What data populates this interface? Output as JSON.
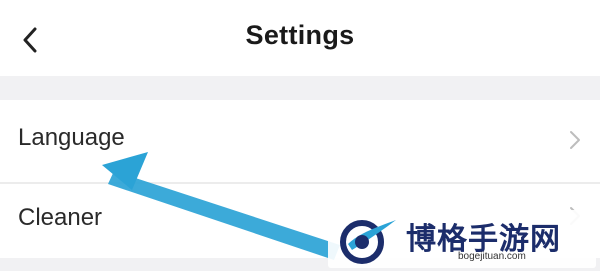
{
  "header": {
    "title": "Settings",
    "back_icon": "chevron-left-icon"
  },
  "settings": {
    "items": [
      {
        "label": "Language",
        "icon": "chevron-right-icon"
      },
      {
        "label": "Cleaner",
        "icon": "chevron-right-icon"
      }
    ]
  },
  "overlay": {
    "arrow_color": "#2ba3d6",
    "watermark_text": "博格手游网",
    "watermark_url": "bogejituan.com"
  }
}
